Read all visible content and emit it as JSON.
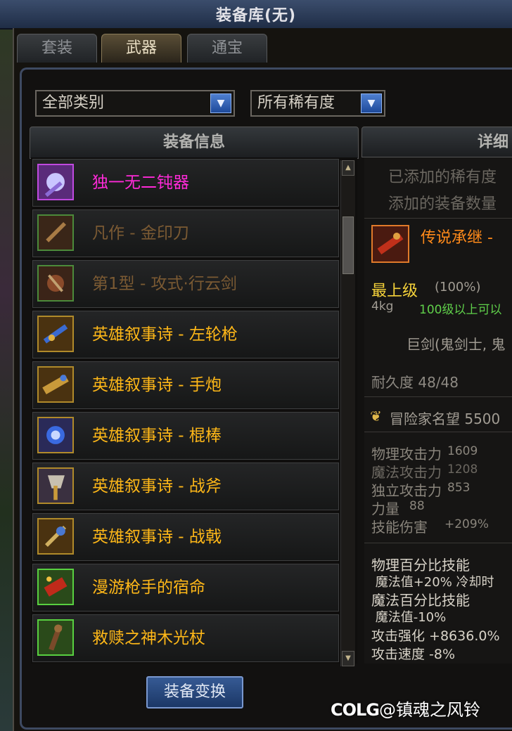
{
  "title": "装备库(无)",
  "tabs": [
    {
      "label": "套装",
      "active": false
    },
    {
      "label": "武器",
      "active": true
    },
    {
      "label": "通宝",
      "active": false
    }
  ],
  "filters": {
    "category": "全部类别",
    "rarity": "所有稀有度"
  },
  "columns": {
    "list_header": "装备信息",
    "detail_header": "详细"
  },
  "items": [
    {
      "name": "独一无二钝器",
      "color": "#ff2ad8"
    },
    {
      "name": "凡作 - 金印刀",
      "color": "#7b5a33"
    },
    {
      "name": "第1型 - 攻式·行云剑",
      "color": "#7b5a33"
    },
    {
      "name": "英雄叙事诗 - 左轮枪",
      "color": "#ffb818"
    },
    {
      "name": "英雄叙事诗 - 手炮",
      "color": "#ffb818"
    },
    {
      "name": "英雄叙事诗 - 棍棒",
      "color": "#ffb818"
    },
    {
      "name": "英雄叙事诗 - 战斧",
      "color": "#ffb818"
    },
    {
      "name": "英雄叙事诗 - 战戟",
      "color": "#ffb818"
    },
    {
      "name": "漫游枪手的宿命",
      "color": "#ffb818"
    },
    {
      "name": "救赎之神木光杖",
      "color": "#ffb818"
    }
  ],
  "swap_button": "装备变换",
  "detail": {
    "added_rarity": "已添加的稀有度",
    "added_count": "添加的装备数量",
    "item_name": "传说承继 -",
    "grade": "最上级",
    "grade_pct": "(100%)",
    "weight": "4kg",
    "level_req": "100级以上可以",
    "class_req": "巨剑(鬼剑士, 鬼",
    "durability": "耐久度 48/48",
    "fame": "冒险家名望 5500",
    "stats": [
      {
        "label": "物理攻击力",
        "value": "1609"
      },
      {
        "label": "魔法攻击力",
        "value": "1208"
      },
      {
        "label": "独立攻击力",
        "value": "853"
      },
      {
        "label": "力量",
        "value": "88"
      },
      {
        "label": "技能伤害",
        "value": "+209%"
      }
    ],
    "skills": [
      "物理百分比技能",
      " 魔法值+20% 冷却时",
      "魔法百分比技能",
      " 魔法值-10%",
      "攻击强化 +8636.0%",
      "攻击速度 -8%"
    ]
  },
  "watermark": {
    "brand": "COLG",
    "user": "@镇魂之风铃"
  }
}
